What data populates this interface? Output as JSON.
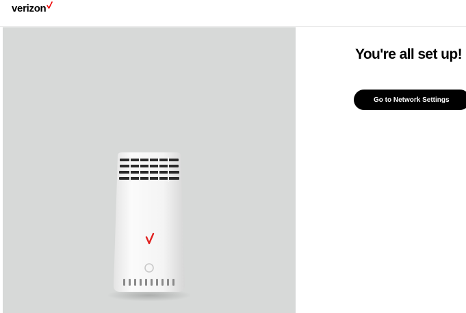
{
  "header": {
    "brand": "verizon",
    "check_color": "#ee0000"
  },
  "hero": {
    "background": "#d7d9d8",
    "image": "verizon-router-image"
  },
  "panel": {
    "title": "You're all set up!",
    "cta_label": "Go to Network Settings"
  }
}
